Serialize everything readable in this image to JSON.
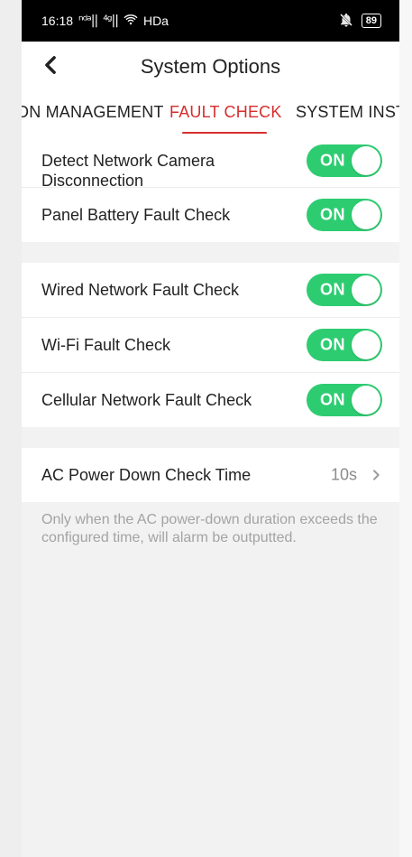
{
  "statusbar": {
    "time": "16:18",
    "signal_1": "ⁿᵈᵃ||",
    "signal_2": "⁴ᵍ||",
    "network": "HDa",
    "battery": "89"
  },
  "header": {
    "title": "System Options"
  },
  "tabs": [
    {
      "label": "ON MANAGEMENT"
    },
    {
      "label": "FAULT CHECK"
    },
    {
      "label": "SYSTEM INSTRU"
    }
  ],
  "groups": {
    "group1": [
      {
        "label": "Detect Network Camera\nDisconnection",
        "state": "ON"
      },
      {
        "label": "Panel Battery Fault Check",
        "state": "ON"
      }
    ],
    "group2": [
      {
        "label": "Wired Network Fault Check",
        "state": "ON"
      },
      {
        "label": "Wi-Fi Fault Check",
        "state": "ON"
      },
      {
        "label": "Cellular Network Fault Check",
        "state": "ON"
      }
    ],
    "group3": [
      {
        "label": "AC Power Down Check Time",
        "value": "10s"
      }
    ]
  },
  "footnote": "Only when the AC power-down duration exceeds the configured time, will alarm be outputted.",
  "colors": {
    "accent_red": "#d62d2d",
    "toggle_green": "#2ecc71",
    "bg_gray": "#f2f2f2"
  },
  "icons": {
    "back": "chevron-left-icon",
    "chevron_right": "chevron-right-icon",
    "wifi": "wifi-icon",
    "battery": "battery-icon",
    "mute": "bell-off-icon"
  }
}
